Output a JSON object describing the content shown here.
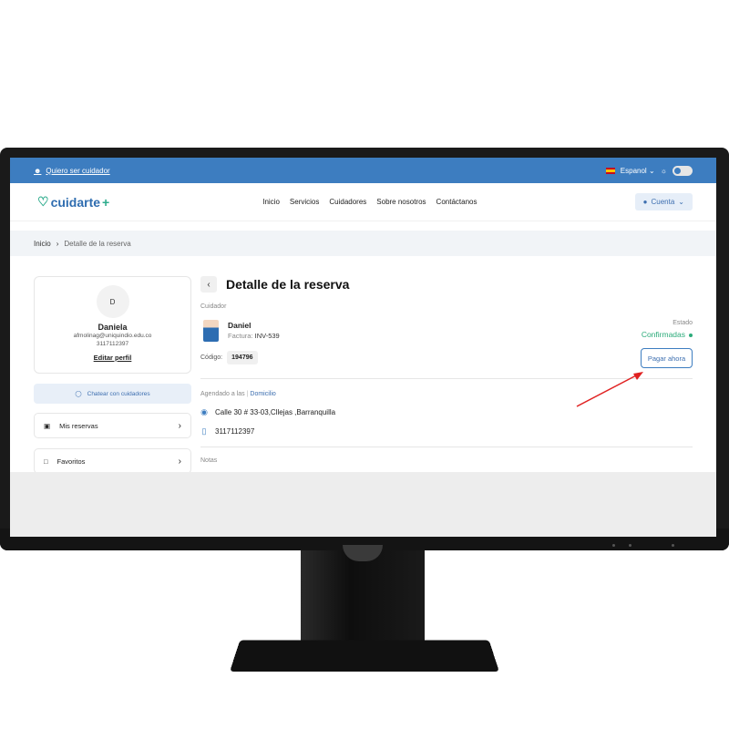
{
  "topbar": {
    "caregiver_link": "Quiero ser cuidador",
    "language": "Espanol"
  },
  "nav": {
    "logo_text": "cuidarte",
    "logo_plus": "+",
    "links": [
      "Inicio",
      "Servicios",
      "Cuidadores",
      "Sobre nosotros",
      "Contáctanos"
    ],
    "account_label": "Cuenta"
  },
  "breadcrumb": {
    "home": "Inicio",
    "current": "Detalle de la reserva"
  },
  "profile": {
    "initial": "D",
    "name": "Daniela",
    "email": "afmolinag@uniquindio.edu.co",
    "phone": "3117112397",
    "edit_label": "Editar perfil"
  },
  "sidebar": {
    "chat_label": "Chatear con cuidadores",
    "items": [
      {
        "label": "Mis reservas"
      },
      {
        "label": "Favoritos"
      }
    ]
  },
  "detail": {
    "title": "Detalle de la reserva",
    "caregiver_label": "Cuidador",
    "caregiver_name": "Daniel",
    "invoice_label": "Factura:",
    "invoice_value": "INV-539",
    "status_label": "Estado",
    "status_value": "Confirmadas",
    "code_label": "Código:",
    "code_value": "194796",
    "pay_button": "Pagar ahora",
    "scheduled_label": "Agendado a las",
    "scheduled_type": "Domicilio",
    "address": "Calle 30 # 33-03,Cllejas ,Barranquilla",
    "phone": "3117112397",
    "notes_label": "Notas"
  },
  "colors": {
    "brand_blue": "#3d7dc0",
    "status_green": "#2cab7a",
    "arrow_red": "#e02020"
  }
}
